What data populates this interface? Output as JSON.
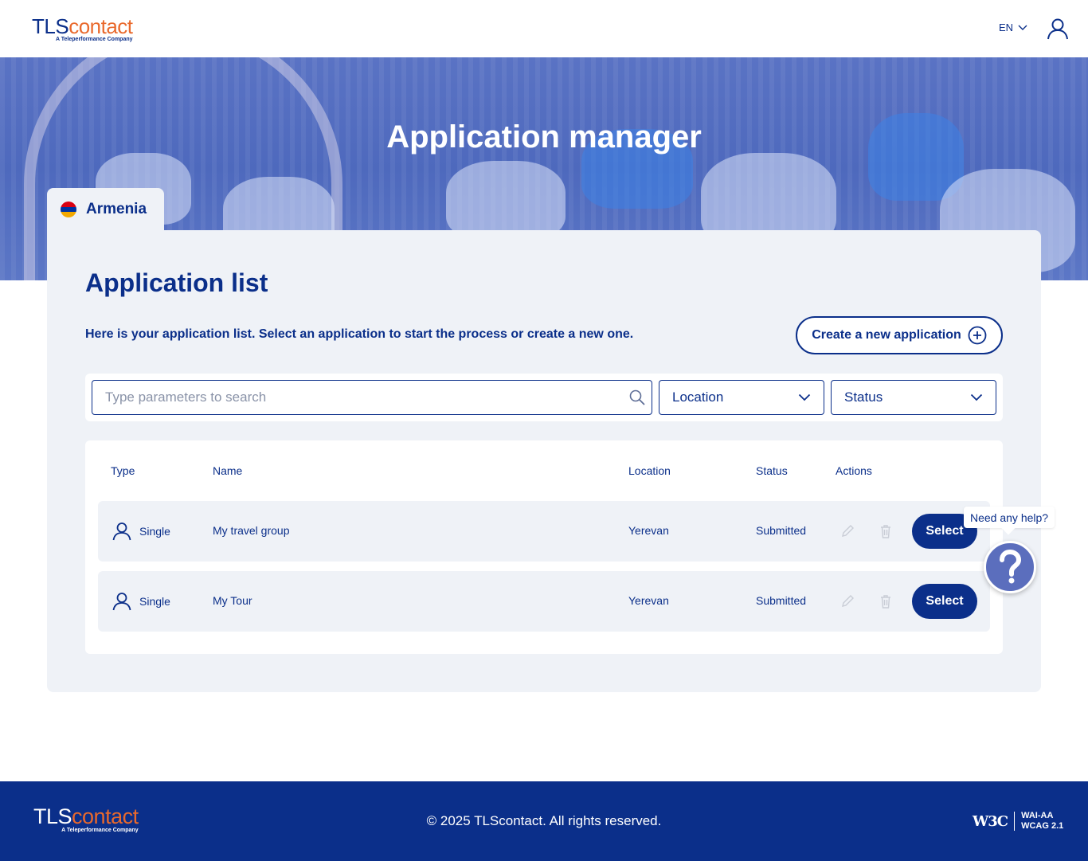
{
  "header": {
    "logo_primary": "TLS",
    "logo_secondary": "contact",
    "logo_tagline": "A Teleperformance Company",
    "language": "EN"
  },
  "hero": {
    "title": "Application manager"
  },
  "country_tab": {
    "label": "Armenia",
    "flag_colors": [
      "#d90012",
      "#0033a0",
      "#f2a800"
    ]
  },
  "panel": {
    "title": "Application list",
    "description": "Here is your application list. Select an application to start the process or create a new one.",
    "create_button": "Create a new application"
  },
  "filters": {
    "search_placeholder": "Type parameters to search",
    "location_label": "Location",
    "status_label": "Status"
  },
  "table": {
    "headers": {
      "type": "Type",
      "name": "Name",
      "location": "Location",
      "status": "Status",
      "actions": "Actions"
    },
    "rows": [
      {
        "type": "Single",
        "name": "My travel group",
        "location": "Yerevan",
        "status": "Submitted",
        "action": "Select"
      },
      {
        "type": "Single",
        "name": "My Tour",
        "location": "Yerevan",
        "status": "Submitted",
        "action": "Select"
      }
    ]
  },
  "help": {
    "bubble": "Need any help?"
  },
  "footer": {
    "logo_primary": "TLS",
    "logo_secondary": "contact",
    "logo_tagline": "A Teleperformance Company",
    "copyright": "© 2025 TLScontact. All rights reserved.",
    "w3c": "W3C",
    "wai_line1": "WAI-AA",
    "wai_line2": "WCAG 2.1"
  },
  "colors": {
    "brand_blue": "#0b2f8a",
    "brand_orange": "#e9692c",
    "panel_bg": "#eff2f7"
  }
}
